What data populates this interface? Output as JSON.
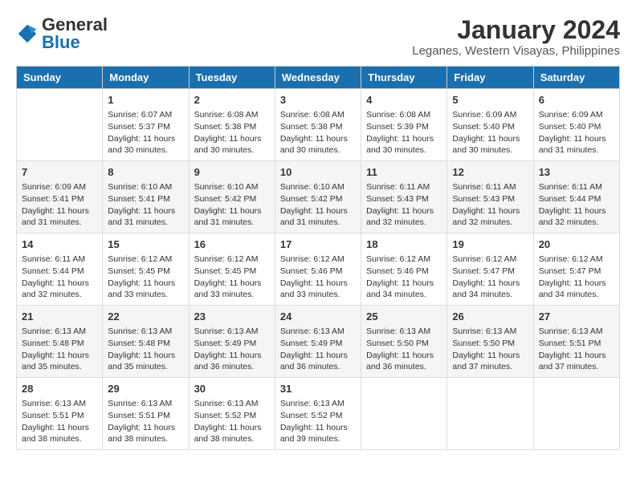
{
  "logo": {
    "general": "General",
    "blue": "Blue"
  },
  "title": "January 2024",
  "subtitle": "Leganes, Western Visayas, Philippines",
  "days_header": [
    "Sunday",
    "Monday",
    "Tuesday",
    "Wednesday",
    "Thursday",
    "Friday",
    "Saturday"
  ],
  "weeks": [
    [
      {
        "num": "",
        "info": ""
      },
      {
        "num": "1",
        "info": "Sunrise: 6:07 AM\nSunset: 5:37 PM\nDaylight: 11 hours\nand 30 minutes."
      },
      {
        "num": "2",
        "info": "Sunrise: 6:08 AM\nSunset: 5:38 PM\nDaylight: 11 hours\nand 30 minutes."
      },
      {
        "num": "3",
        "info": "Sunrise: 6:08 AM\nSunset: 5:38 PM\nDaylight: 11 hours\nand 30 minutes."
      },
      {
        "num": "4",
        "info": "Sunrise: 6:08 AM\nSunset: 5:39 PM\nDaylight: 11 hours\nand 30 minutes."
      },
      {
        "num": "5",
        "info": "Sunrise: 6:09 AM\nSunset: 5:40 PM\nDaylight: 11 hours\nand 30 minutes."
      },
      {
        "num": "6",
        "info": "Sunrise: 6:09 AM\nSunset: 5:40 PM\nDaylight: 11 hours\nand 31 minutes."
      }
    ],
    [
      {
        "num": "7",
        "info": "Sunrise: 6:09 AM\nSunset: 5:41 PM\nDaylight: 11 hours\nand 31 minutes."
      },
      {
        "num": "8",
        "info": "Sunrise: 6:10 AM\nSunset: 5:41 PM\nDaylight: 11 hours\nand 31 minutes."
      },
      {
        "num": "9",
        "info": "Sunrise: 6:10 AM\nSunset: 5:42 PM\nDaylight: 11 hours\nand 31 minutes."
      },
      {
        "num": "10",
        "info": "Sunrise: 6:10 AM\nSunset: 5:42 PM\nDaylight: 11 hours\nand 31 minutes."
      },
      {
        "num": "11",
        "info": "Sunrise: 6:11 AM\nSunset: 5:43 PM\nDaylight: 11 hours\nand 32 minutes."
      },
      {
        "num": "12",
        "info": "Sunrise: 6:11 AM\nSunset: 5:43 PM\nDaylight: 11 hours\nand 32 minutes."
      },
      {
        "num": "13",
        "info": "Sunrise: 6:11 AM\nSunset: 5:44 PM\nDaylight: 11 hours\nand 32 minutes."
      }
    ],
    [
      {
        "num": "14",
        "info": "Sunrise: 6:11 AM\nSunset: 5:44 PM\nDaylight: 11 hours\nand 32 minutes."
      },
      {
        "num": "15",
        "info": "Sunrise: 6:12 AM\nSunset: 5:45 PM\nDaylight: 11 hours\nand 33 minutes."
      },
      {
        "num": "16",
        "info": "Sunrise: 6:12 AM\nSunset: 5:45 PM\nDaylight: 11 hours\nand 33 minutes."
      },
      {
        "num": "17",
        "info": "Sunrise: 6:12 AM\nSunset: 5:46 PM\nDaylight: 11 hours\nand 33 minutes."
      },
      {
        "num": "18",
        "info": "Sunrise: 6:12 AM\nSunset: 5:46 PM\nDaylight: 11 hours\nand 34 minutes."
      },
      {
        "num": "19",
        "info": "Sunrise: 6:12 AM\nSunset: 5:47 PM\nDaylight: 11 hours\nand 34 minutes."
      },
      {
        "num": "20",
        "info": "Sunrise: 6:12 AM\nSunset: 5:47 PM\nDaylight: 11 hours\nand 34 minutes."
      }
    ],
    [
      {
        "num": "21",
        "info": "Sunrise: 6:13 AM\nSunset: 5:48 PM\nDaylight: 11 hours\nand 35 minutes."
      },
      {
        "num": "22",
        "info": "Sunrise: 6:13 AM\nSunset: 5:48 PM\nDaylight: 11 hours\nand 35 minutes."
      },
      {
        "num": "23",
        "info": "Sunrise: 6:13 AM\nSunset: 5:49 PM\nDaylight: 11 hours\nand 36 minutes."
      },
      {
        "num": "24",
        "info": "Sunrise: 6:13 AM\nSunset: 5:49 PM\nDaylight: 11 hours\nand 36 minutes."
      },
      {
        "num": "25",
        "info": "Sunrise: 6:13 AM\nSunset: 5:50 PM\nDaylight: 11 hours\nand 36 minutes."
      },
      {
        "num": "26",
        "info": "Sunrise: 6:13 AM\nSunset: 5:50 PM\nDaylight: 11 hours\nand 37 minutes."
      },
      {
        "num": "27",
        "info": "Sunrise: 6:13 AM\nSunset: 5:51 PM\nDaylight: 11 hours\nand 37 minutes."
      }
    ],
    [
      {
        "num": "28",
        "info": "Sunrise: 6:13 AM\nSunset: 5:51 PM\nDaylight: 11 hours\nand 38 minutes."
      },
      {
        "num": "29",
        "info": "Sunrise: 6:13 AM\nSunset: 5:51 PM\nDaylight: 11 hours\nand 38 minutes."
      },
      {
        "num": "30",
        "info": "Sunrise: 6:13 AM\nSunset: 5:52 PM\nDaylight: 11 hours\nand 38 minutes."
      },
      {
        "num": "31",
        "info": "Sunrise: 6:13 AM\nSunset: 5:52 PM\nDaylight: 11 hours\nand 39 minutes."
      },
      {
        "num": "",
        "info": ""
      },
      {
        "num": "",
        "info": ""
      },
      {
        "num": "",
        "info": ""
      }
    ]
  ]
}
